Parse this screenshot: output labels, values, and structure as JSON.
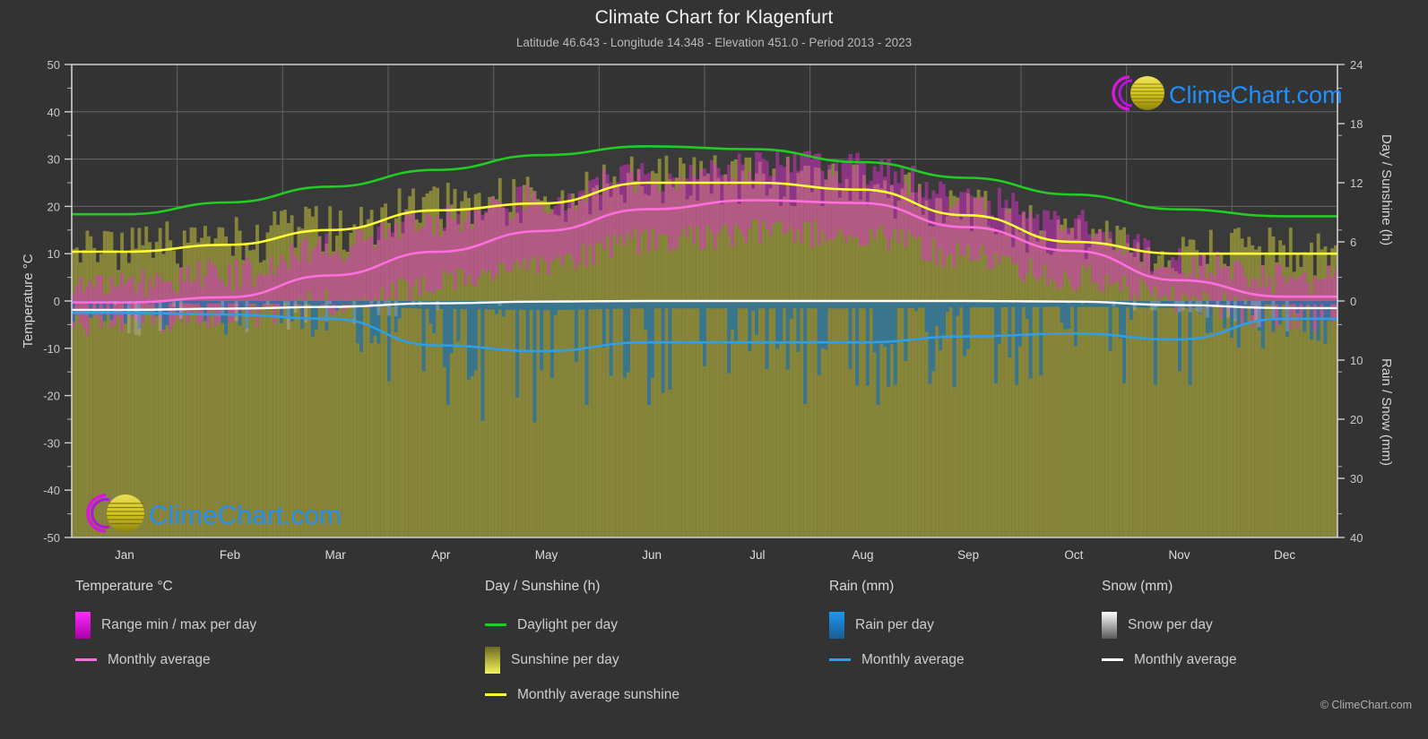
{
  "header": {
    "title": "Climate Chart for Klagenfurt",
    "subtitle": "Latitude 46.643 - Longitude 14.348 - Elevation 451.0 - Period 2013 - 2023"
  },
  "branding": {
    "logo_text": "ClimeChart.com",
    "copyright": "© ClimeChart.com"
  },
  "axes": {
    "left_title": "Temperature °C",
    "right_top_title": "Day / Sunshine (h)",
    "right_bottom_title": "Rain / Snow (mm)",
    "left_ticks": [
      50,
      40,
      30,
      20,
      10,
      0,
      -10,
      -20,
      -30,
      -40,
      -50
    ],
    "right_top_ticks": [
      24,
      18,
      12,
      6,
      0
    ],
    "right_bottom_ticks": [
      0,
      10,
      20,
      30,
      40
    ],
    "months": [
      "Jan",
      "Feb",
      "Mar",
      "Apr",
      "May",
      "Jun",
      "Jul",
      "Aug",
      "Sep",
      "Oct",
      "Nov",
      "Dec"
    ]
  },
  "legend": {
    "temperature": {
      "title": "Temperature °C",
      "items": [
        {
          "label": "Range min / max per day",
          "type": "box",
          "color": "#ff00ff"
        },
        {
          "label": "Monthly average",
          "type": "line",
          "color": "#ff6edd"
        }
      ]
    },
    "sunshine": {
      "title": "Day / Sunshine (h)",
      "items": [
        {
          "label": "Daylight per day",
          "type": "line",
          "color": "#22cc22"
        },
        {
          "label": "Sunshine per day",
          "type": "box",
          "color": "#eded3a"
        },
        {
          "label": "Monthly average sunshine",
          "type": "line",
          "color": "#ffff33"
        }
      ]
    },
    "rain": {
      "title": "Rain (mm)",
      "items": [
        {
          "label": "Rain per day",
          "type": "box",
          "color": "#0b84e0"
        },
        {
          "label": "Monthly average",
          "type": "line",
          "color": "#2f9fe8"
        }
      ]
    },
    "snow": {
      "title": "Snow (mm)",
      "items": [
        {
          "label": "Snow per day",
          "type": "box",
          "color": "#f2f2f2"
        },
        {
          "label": "Monthly average",
          "type": "line",
          "color": "#ffffff"
        }
      ]
    }
  },
  "colors": {
    "background": "#333333",
    "plot_background": "#343434",
    "grid": "#6e6e6e",
    "axis": "#d0d0d0",
    "daylight": "#22cc22",
    "sunshine_line": "#ffff33",
    "sunshine_fill": "#b5b33a",
    "temp_range": "#e02fd0",
    "temp_avg": "#ff6edd",
    "rain": "#1b6fae",
    "rain_avg": "#2f9fe8",
    "snow": "#cfcfcf",
    "snow_avg": "#ffffff",
    "brand_blue": "#1e90ff",
    "brand_magenta": "#d916d9",
    "brand_yellow": "#d8cc22"
  },
  "chart_data": {
    "type": "area",
    "title": "Climate Chart for Klagenfurt",
    "subtitle": "Latitude 46.643 - Longitude 14.348 - Elevation 451.0 - Period 2013 - 2023",
    "xlabel": "",
    "ylabel": "Temperature °C",
    "ylim": [
      -50,
      50
    ],
    "y2lim_hours": [
      0,
      24
    ],
    "y2lim_precip": [
      0,
      40
    ],
    "grid": true,
    "legend_position": "below",
    "categories": [
      "Jan",
      "Feb",
      "Mar",
      "Apr",
      "May",
      "Jun",
      "Jul",
      "Aug",
      "Sep",
      "Oct",
      "Nov",
      "Dec"
    ],
    "series": [
      {
        "name": "Daylight per day",
        "unit": "h",
        "axis": "right_top",
        "values": [
          8.8,
          10.0,
          11.6,
          13.3,
          14.8,
          15.7,
          15.4,
          14.1,
          12.5,
          10.8,
          9.3,
          8.6
        ]
      },
      {
        "name": "Monthly average sunshine",
        "unit": "h",
        "axis": "right_top",
        "values": [
          5.0,
          5.7,
          7.2,
          9.2,
          9.9,
          12.0,
          12.0,
          11.3,
          8.7,
          6.0,
          4.8,
          4.8
        ]
      },
      {
        "name": "Temperature monthly average",
        "unit": "°C",
        "axis": "left",
        "values": [
          -0.3,
          0.8,
          5.4,
          10.4,
          14.8,
          19.4,
          21.3,
          20.7,
          15.6,
          10.6,
          4.4,
          0.9
        ]
      },
      {
        "name": "Temperature range max per day",
        "unit": "°C",
        "axis": "left",
        "values": [
          3.5,
          5.5,
          11.5,
          17.0,
          21.5,
          26.5,
          28.5,
          28.0,
          22.0,
          16.0,
          8.5,
          4.5
        ]
      },
      {
        "name": "Temperature range min per day",
        "unit": "°C",
        "axis": "left",
        "values": [
          -4.5,
          -3.5,
          -0.5,
          3.5,
          8.0,
          12.5,
          14.5,
          14.0,
          9.5,
          5.0,
          0.5,
          -3.5
        ]
      },
      {
        "name": "Rain monthly average",
        "unit": "mm",
        "axis": "right_bottom",
        "values": [
          2.0,
          2.3,
          3.0,
          7.5,
          8.5,
          7.0,
          7.0,
          7.0,
          6.0,
          5.5,
          6.5,
          3.0
        ]
      },
      {
        "name": "Snow monthly average",
        "unit": "mm",
        "axis": "right_bottom",
        "values": [
          1.5,
          1.3,
          1.0,
          0.4,
          0.1,
          0.0,
          0.0,
          0.0,
          0.0,
          0.1,
          0.7,
          1.2
        ]
      }
    ]
  }
}
